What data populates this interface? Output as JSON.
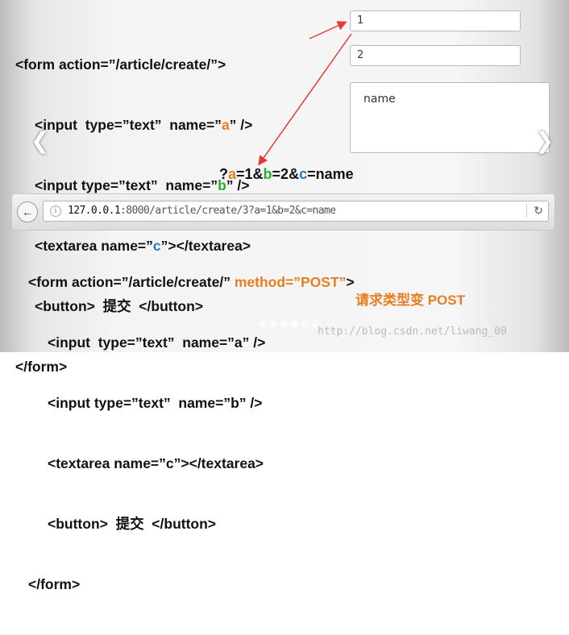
{
  "slide_top": {
    "line1_pre": "<form action=”/article/create/”>",
    "line2_pre": "<input  type=”text”  name=”",
    "line2_name": "a",
    "line2_post": "” />",
    "line3_pre": "<input type=”text”  name=”",
    "line3_name": "b",
    "line3_post": "” />",
    "line4_pre": "<textarea name=”",
    "line4_name": "c",
    "line4_post": "”></textarea>",
    "line5": "<button>  提交  </button>",
    "line6": "</form>"
  },
  "form_demo": {
    "input_a_value": "1",
    "input_b_value": "2",
    "textarea_value": "name"
  },
  "query": {
    "q": "?",
    "a": "a",
    "eq1": "=1&",
    "b": "b",
    "eq2": "=2&",
    "c": "c",
    "eq3": "=name"
  },
  "browser": {
    "back_icon": "arrow-left-icon",
    "url_host": "127.0.0.1",
    "url_rest": ":8000/article/create/3?a=1&b=2&c=name",
    "reload_icon": "reload-icon"
  },
  "slide_bottom": {
    "line1_pre": "<form action=”/article/create/”",
    "line1_method": "method=”POST”",
    "line1_post": ">",
    "line2": "<input  type=”text”  name=”a” />",
    "line3": "<input type=”text”  name=”b” />",
    "line4": "<textarea name=”c”></textarea>",
    "line5": "<button>  提交  </button>",
    "line6": "</form>"
  },
  "note": "请求类型变 POST",
  "watermark": "http://blog.csdn.net/liwang_00",
  "nav": {
    "left": "❮",
    "right": "❯"
  },
  "colors": {
    "accent": "#e67e22",
    "green": "#27ae2a",
    "blue": "#1f78c8",
    "arrow": "#e53935"
  }
}
